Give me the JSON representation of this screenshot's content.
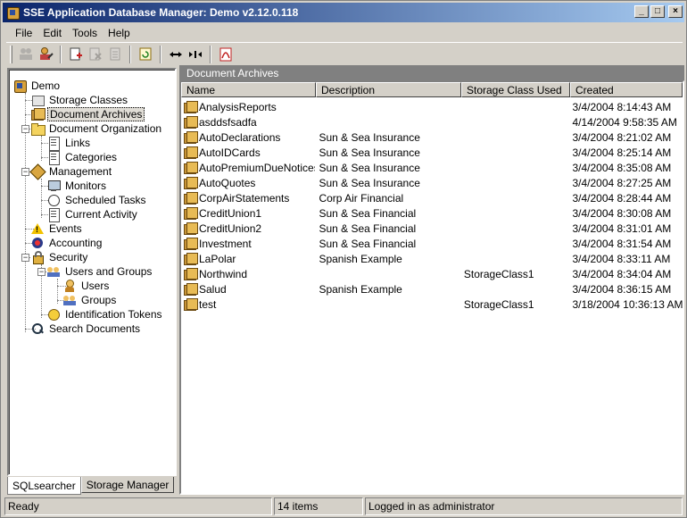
{
  "window": {
    "title": "SSE Application Database Manager: Demo  v2.12.0.118",
    "minimize": "_",
    "maximize": "□",
    "close": "×"
  },
  "menu": [
    "File",
    "Edit",
    "Tools",
    "Help"
  ],
  "toolbar": {
    "buttons": [
      "users-icon",
      "user-edit-icon",
      "document-add-icon",
      "document-remove-icon",
      "document-icon",
      "refresh-icon",
      "move-left-right-icon",
      "collapse-icon",
      "pdf-icon"
    ]
  },
  "tree": {
    "root": "Demo",
    "storage_classes": "Storage Classes",
    "document_archives": "Document Archives",
    "document_organization": "Document Organization",
    "links": "Links",
    "categories": "Categories",
    "management": "Management",
    "monitors": "Monitors",
    "scheduled_tasks": "Scheduled Tasks",
    "current_activity": "Current Activity",
    "events": "Events",
    "accounting": "Accounting",
    "security": "Security",
    "users_and_groups": "Users and Groups",
    "users": "Users",
    "groups": "Groups",
    "identification_tokens": "Identification Tokens",
    "search_documents": "Search Documents",
    "expander_collapse": "−"
  },
  "tabs": [
    "SQLsearcher",
    "Storage Manager"
  ],
  "panel": {
    "title": "Document Archives",
    "columns": [
      "Name",
      "Description",
      "Storage Class Used",
      "Created"
    ],
    "rows": [
      {
        "name": "AnalysisReports",
        "description": "",
        "storage_class": "",
        "created": "3/4/2004 8:14:43 AM"
      },
      {
        "name": "asddsfsadfa",
        "description": "",
        "storage_class": "",
        "created": "4/14/2004 9:58:35 AM"
      },
      {
        "name": "AutoDeclarations",
        "description": "Sun & Sea Insurance",
        "storage_class": "",
        "created": "3/4/2004 8:21:02 AM"
      },
      {
        "name": "AutoIDCards",
        "description": "Sun & Sea Insurance",
        "storage_class": "",
        "created": "3/4/2004 8:25:14 AM"
      },
      {
        "name": "AutoPremiumDueNotices",
        "description": "Sun & Sea Insurance",
        "storage_class": "",
        "created": "3/4/2004 8:35:08 AM"
      },
      {
        "name": "AutoQuotes",
        "description": "Sun & Sea Insurance",
        "storage_class": "",
        "created": "3/4/2004 8:27:25 AM"
      },
      {
        "name": "CorpAirStatements",
        "description": "Corp Air Financial",
        "storage_class": "",
        "created": "3/4/2004 8:28:44 AM"
      },
      {
        "name": "CreditUnion1",
        "description": "Sun & Sea Financial",
        "storage_class": "",
        "created": "3/4/2004 8:30:08 AM"
      },
      {
        "name": "CreditUnion2",
        "description": "Sun & Sea Financial",
        "storage_class": "",
        "created": "3/4/2004 8:31:01 AM"
      },
      {
        "name": "Investment",
        "description": "Sun & Sea Financial",
        "storage_class": "",
        "created": "3/4/2004 8:31:54 AM"
      },
      {
        "name": "LaPolar",
        "description": "Spanish Example",
        "storage_class": "",
        "created": "3/4/2004 8:33:11 AM"
      },
      {
        "name": "Northwind",
        "description": "",
        "storage_class": "StorageClass1",
        "created": "3/4/2004 8:34:04 AM"
      },
      {
        "name": "Salud",
        "description": "Spanish Example",
        "storage_class": "",
        "created": "3/4/2004 8:36:15 AM"
      },
      {
        "name": "test",
        "description": "",
        "storage_class": "StorageClass1",
        "created": "3/18/2004 10:36:13 AM"
      }
    ]
  },
  "status": {
    "ready": "Ready",
    "items": "14 items",
    "user": "Logged in as administrator"
  }
}
